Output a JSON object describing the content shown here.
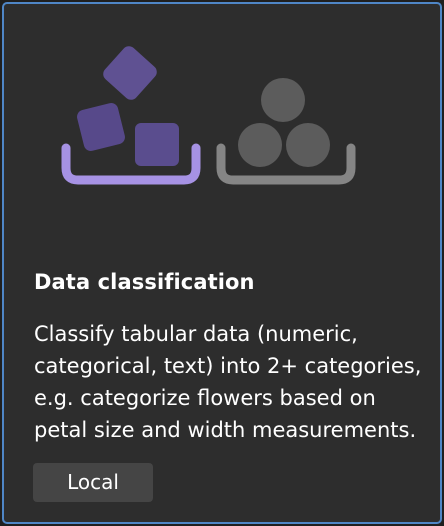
{
  "card": {
    "title": "Data classification",
    "description": "Classify tabular data (numeric, categorical, text) into 2+ categories, e.g. categorize flowers based on petal size and width measurements.",
    "tag_label": "Local",
    "border_color": "#4f86c6",
    "background_color": "#2d2d2d"
  },
  "illustration": {
    "left_icon": "purple-squares-in-bin-icon",
    "right_icon": "gray-circles-in-bin-icon",
    "accent_purple": "#a28fe0",
    "square_color": "#5b4e8c",
    "circle_color": "#5a5a5a",
    "bin_gray": "#808080"
  }
}
